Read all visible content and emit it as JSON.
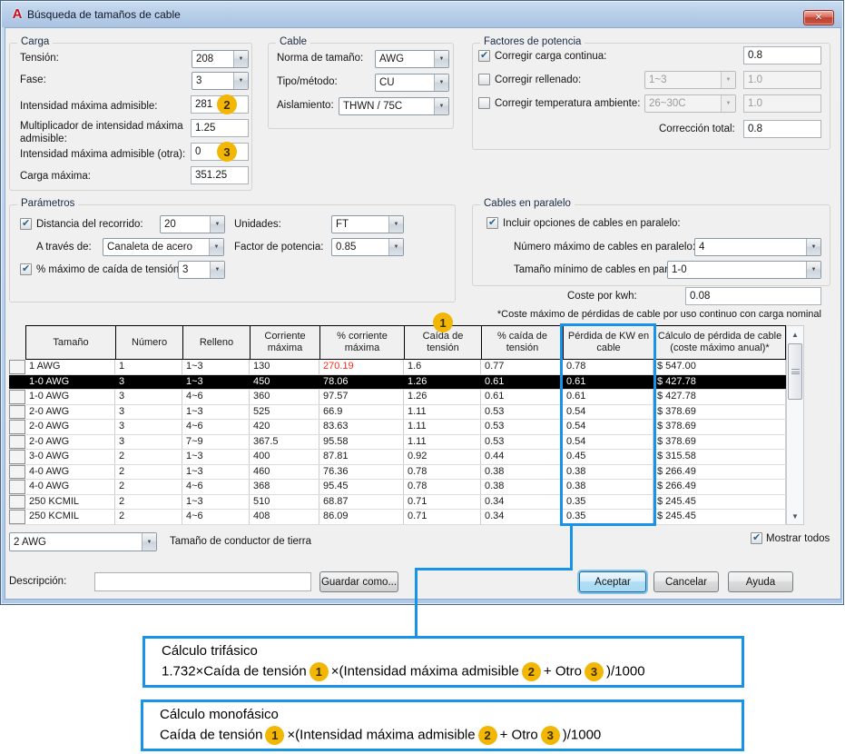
{
  "icons": {
    "close": "✕",
    "combo_arrow": "▼",
    "scroll_up": "▲",
    "scroll_down": "▼",
    "logo": "A"
  },
  "colors": {
    "accent_blue": "#1793e8",
    "badge_yellow": "#f2b705",
    "red_value": "#ff2d1e",
    "selected_row_bg": "#000000"
  },
  "window": {
    "title": "Búsqueda de tamaños de cable"
  },
  "badges": {
    "b1": "1",
    "b2": "2",
    "b3": "3"
  },
  "carga": {
    "title": "Carga",
    "tension_label": "Tensión:",
    "tension_value": "208",
    "fase_label": "Fase:",
    "fase_value": "3",
    "intensidad_label": "Intensidad máxima admisible:",
    "intensidad_value": "281",
    "multiplicador_label": "Multiplicador de intensidad máxima admisible:",
    "multiplicador_value": "1.25",
    "intensidad_otra_label": "Intensidad máxima admisible (otra):",
    "intensidad_otra_value": "0",
    "carga_maxima_label": "Carga máxima:",
    "carga_maxima_value": "351.25"
  },
  "cable": {
    "title": "Cable",
    "norma_label": "Norma de tamaño:",
    "norma_value": "AWG",
    "tipo_label": "Tipo/método:",
    "tipo_value": "CU",
    "aislamiento_label": "Aislamiento:",
    "aislamiento_value": "THWN / 75C"
  },
  "factores": {
    "title": "Factores de potencia",
    "carga_continua_label": "Corregir carga continua:",
    "carga_continua_checked": true,
    "carga_continua_value": "0.8",
    "rellenado_label": "Corregir rellenado:",
    "rellenado_checked": false,
    "rellenado_combo": "1~3",
    "rellenado_value": "1.0",
    "temperatura_label": "Corregir temperatura ambiente:",
    "temperatura_checked": false,
    "temperatura_combo": "26~30C",
    "temperatura_value": "1.0",
    "correccion_label": "Corrección total:",
    "correccion_value": "0.8"
  },
  "parametros": {
    "title": "Parámetros",
    "distancia_label": "Distancia del recorrido:",
    "distancia_checked": true,
    "distancia_value": "20",
    "unidades_label": "Unidades:",
    "unidades_value": "FT",
    "traves_label": "A través de:",
    "traves_value": "Canaleta de acero",
    "factor_label": "Factor de potencia:",
    "factor_value": "0.85",
    "caida_label": "% máximo de caída de tensión:",
    "caida_checked": true,
    "caida_value": "3"
  },
  "paralelo": {
    "title": "Cables en paralelo",
    "incluir_label": "Incluir opciones de cables en paralelo:",
    "incluir_checked": true,
    "numero_label": "Número máximo de cables en paralelo:",
    "numero_value": "4",
    "tamano_label": "Tamaño mínimo de cables en paralelo:",
    "tamano_value": "1-0"
  },
  "coste": {
    "label": "Coste por kwh:",
    "value": "0.08",
    "footnote": "*Coste máximo de pérdidas de cable por uso continuo con carga nominal"
  },
  "table": {
    "headers": [
      "",
      "Tamaño",
      "Número",
      "Relleno",
      "Corriente máxima",
      "% corriente máxima",
      "Caída de tensión",
      "% caída de tensión",
      "Pérdida de KW en cable",
      "Cálculo de pérdida de cable (coste máximo anual)*"
    ],
    "rows": [
      [
        "1 AWG",
        "1",
        "1~3",
        "130",
        "270.19",
        "1.6",
        "0.77",
        "0.78",
        "$ 547.00"
      ],
      [
        "1-0 AWG",
        "3",
        "1~3",
        "450",
        "78.06",
        "1.26",
        "0.61",
        "0.61",
        "$ 427.78"
      ],
      [
        "1-0 AWG",
        "3",
        "4~6",
        "360",
        "97.57",
        "1.26",
        "0.61",
        "0.61",
        "$ 427.78"
      ],
      [
        "2-0 AWG",
        "3",
        "1~3",
        "525",
        "66.9",
        "1.11",
        "0.53",
        "0.54",
        "$ 378.69"
      ],
      [
        "2-0 AWG",
        "3",
        "4~6",
        "420",
        "83.63",
        "1.11",
        "0.53",
        "0.54",
        "$ 378.69"
      ],
      [
        "2-0 AWG",
        "3",
        "7~9",
        "367.5",
        "95.58",
        "1.11",
        "0.53",
        "0.54",
        "$ 378.69"
      ],
      [
        "3-0 AWG",
        "2",
        "1~3",
        "400",
        "87.81",
        "0.92",
        "0.44",
        "0.45",
        "$ 315.58"
      ],
      [
        "4-0 AWG",
        "2",
        "1~3",
        "460",
        "76.36",
        "0.78",
        "0.38",
        "0.38",
        "$ 266.49"
      ],
      [
        "4-0 AWG",
        "2",
        "4~6",
        "368",
        "95.45",
        "0.78",
        "0.38",
        "0.38",
        "$ 266.49"
      ],
      [
        "250 KCMIL",
        "2",
        "1~3",
        "510",
        "68.87",
        "0.71",
        "0.34",
        "0.35",
        "$ 245.45"
      ],
      [
        "250 KCMIL",
        "2",
        "4~6",
        "408",
        "86.09",
        "0.71",
        "0.34",
        "0.35",
        "$ 245.45"
      ]
    ],
    "selected_index": 1,
    "red_cells": [
      [
        0,
        4
      ]
    ]
  },
  "bottom": {
    "tierra_value": "2 AWG",
    "tierra_label": "Tamaño de conductor de tierra",
    "mostrar_label": "Mostrar todos",
    "mostrar_checked": true,
    "descripcion_label": "Descripción:",
    "descripcion_value": "",
    "guardar_label": "Guardar como...",
    "aceptar_label": "Aceptar",
    "cancelar_label": "Cancelar",
    "ayuda_label": "Ayuda"
  },
  "formulas": [
    {
      "title": "Cálculo trifásico",
      "parts": [
        "1.732×Caída de tensión",
        "1",
        "×(Intensidad máxima admisible",
        "2",
        "+ Otro",
        "3",
        ")/1000"
      ]
    },
    {
      "title": "Cálculo monofásico",
      "parts": [
        "Caída de tensión",
        "1",
        "×(Intensidad máxima admisible",
        "2",
        "+ Otro",
        "3",
        ")/1000"
      ]
    }
  ]
}
